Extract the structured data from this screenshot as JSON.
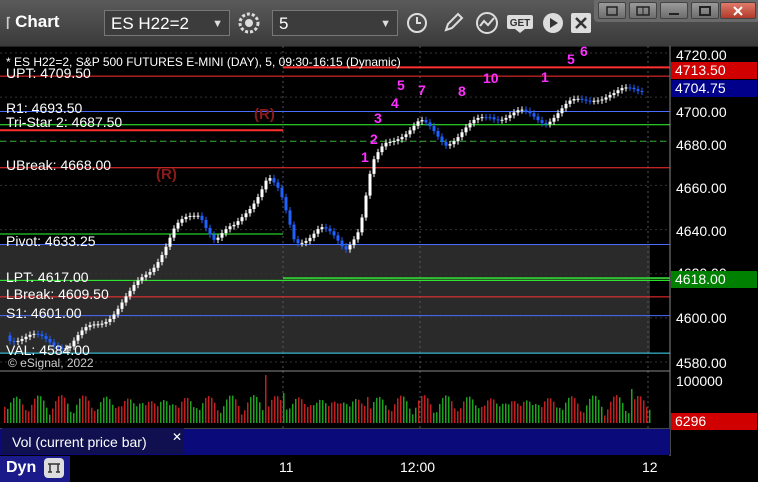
{
  "app": {
    "title": "Chart",
    "icon": "fx-icon"
  },
  "toolbar": {
    "symbol": "ES H22=2",
    "interval": "5",
    "icons": [
      "settings-gear-icon",
      "clock-icon",
      "pencil-icon",
      "study-icon",
      "get-icon",
      "play-icon",
      "close-icon"
    ]
  },
  "window_buttons": [
    "restore-icon",
    "tile-icon",
    "minimize-icon",
    "maximize-icon",
    "close-icon"
  ],
  "chart": {
    "header": "* ES H22=2, S&P 500 FUTURES E-MINI (DAY), 5, 09:30-16:15 (Dynamic)",
    "copyright": "© eSignal, 2022",
    "levels": [
      {
        "label": "UPT: 4709.50",
        "price": 4709.5,
        "color": "#ff3030"
      },
      {
        "label": "R1: 4693.50",
        "price": 4693.5,
        "color": "#4a6cff"
      },
      {
        "label": "Tri-Star 2: 4687.50",
        "price": 4687.5,
        "color": "#30ff30"
      },
      {
        "label": "UBreak: 4668.00",
        "price": 4668.0,
        "color": "#ff3030"
      },
      {
        "label": "Pivot: 4633.25",
        "price": 4633.25,
        "color": "#4a6cff"
      },
      {
        "label": "LPT: 4617.00",
        "price": 4617.0,
        "color": "#30ff30"
      },
      {
        "label": "LBreak: 4609.50",
        "price": 4609.5,
        "color": "#ff3030"
      },
      {
        "label": "S1: 4601.00",
        "price": 4601.0,
        "color": "#4a6cff"
      },
      {
        "label": "VAL: 4584.00",
        "price": 4584.0,
        "color": "#40e0ff"
      }
    ],
    "price_boxes": [
      {
        "text": "4713.50",
        "bg": "#d00000",
        "fg": "#ffffff"
      },
      {
        "text": "4704.75",
        "bg": "#00008b",
        "fg": "#ffffff"
      },
      {
        "text": "4618.00",
        "bg": "#008000",
        "fg": "#ffffff"
      }
    ],
    "price_ticks": [
      "4720.00",
      "4700.00",
      "4680.00",
      "4660.00",
      "4640.00",
      "4620.00",
      "4600.00",
      "4580.00"
    ],
    "markers": [
      "(R)",
      "(R)"
    ],
    "td_counts": [
      "1",
      "2",
      "3",
      "4",
      "5",
      "7",
      "8",
      "10",
      "1",
      "5",
      "6"
    ]
  },
  "volume": {
    "title": "Vol (current price bar)",
    "tick": "100000",
    "current": "6296",
    "current_bg": "#d00000"
  },
  "time_axis": {
    "labels": [
      "11",
      "12:00",
      "12"
    ]
  },
  "status": {
    "label": "Dyn"
  },
  "colors": {
    "up": "#ffffff",
    "down": "#2060ff",
    "grid": "#333333",
    "shade": "#2a2a2a"
  }
}
